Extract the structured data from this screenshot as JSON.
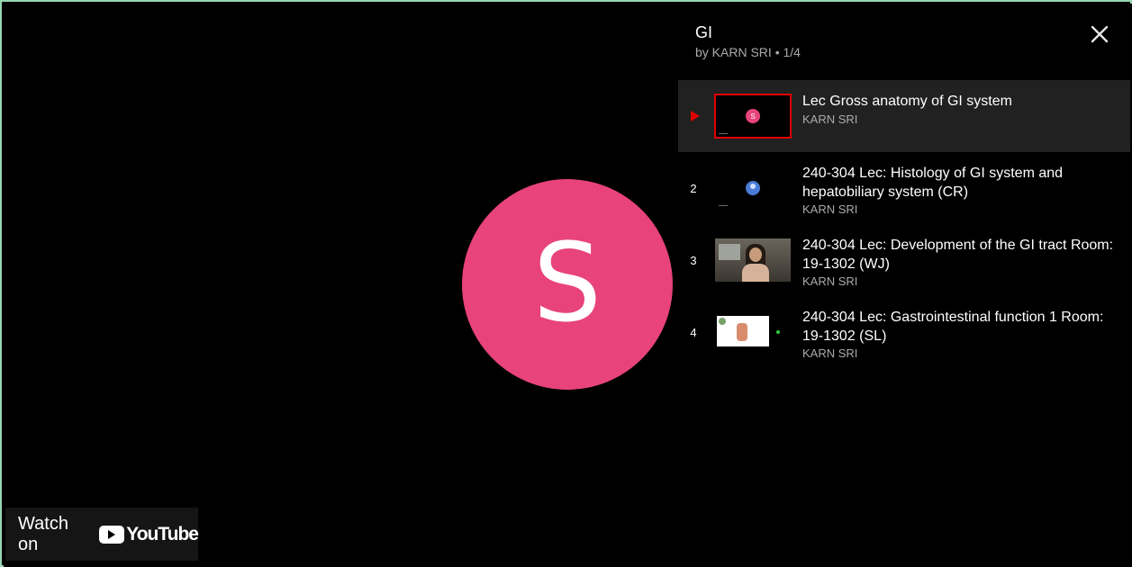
{
  "player": {
    "avatar_letter": "S",
    "watch_on_label": "Watch on",
    "youtube_word": "YouTube"
  },
  "playlist": {
    "title": "GI",
    "subtitle": "by KARN SRI • 1/4",
    "close_icon": "close-icon",
    "items": [
      {
        "index": "",
        "playing": true,
        "title": "Lec Gross anatomy of GI system",
        "author": "KARN SRI",
        "thumb_letter": "S"
      },
      {
        "index": "2",
        "playing": false,
        "title": "240-304 Lec: Histology of GI system and hepatobiliary system (CR)",
        "author": "KARN SRI"
      },
      {
        "index": "3",
        "playing": false,
        "title": "240-304 Lec: Development of the GI tract Room: 19-1302 (WJ)",
        "author": "KARN SRI"
      },
      {
        "index": "4",
        "playing": false,
        "title": "240-304 Lec: Gastrointestinal function 1 Room: 19-1302 (SL)",
        "author": "KARN SRI"
      }
    ]
  },
  "colors": {
    "avatar": "#e8437a",
    "accent_red": "#e30000",
    "active_row": "#212121",
    "frame_border": "#9ad6b4"
  }
}
